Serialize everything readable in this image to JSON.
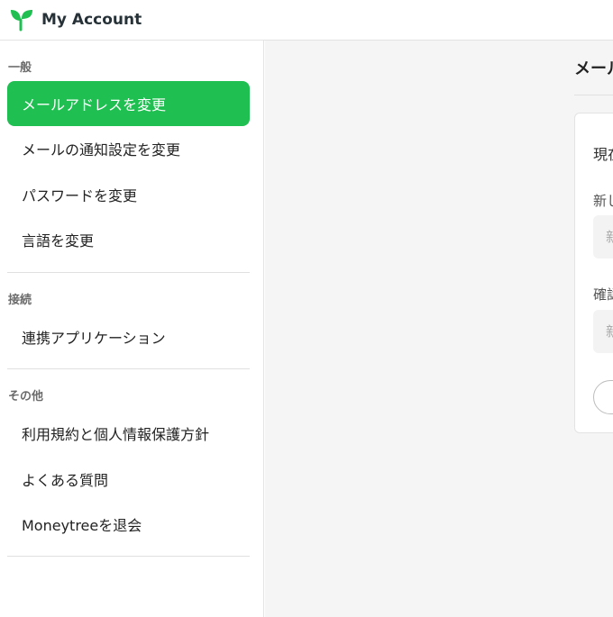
{
  "header": {
    "title": "My Account"
  },
  "sidebar": {
    "sections": [
      {
        "title": "一般",
        "items": [
          "メールアドレスを変更",
          "メールの通知設定を変更",
          "パスワードを変更",
          "言語を変更"
        ]
      },
      {
        "title": "接続",
        "items": [
          "連携アプリケーション"
        ]
      },
      {
        "title": "その他",
        "items": [
          "利用規約と個人情報保護方針",
          "よくある質問",
          "Moneytreeを退会"
        ]
      }
    ],
    "active_item": "メールアドレスを変更"
  },
  "main": {
    "title": "メール",
    "card": {
      "current_label": "現在",
      "new_label": "新し",
      "new_placeholder": "新",
      "confirm_label": "確認",
      "confirm_placeholder": "新"
    }
  },
  "colors": {
    "accent": "#1fbf51",
    "sidebar_bg": "#ffffff",
    "main_bg": "#f5f5f5"
  }
}
